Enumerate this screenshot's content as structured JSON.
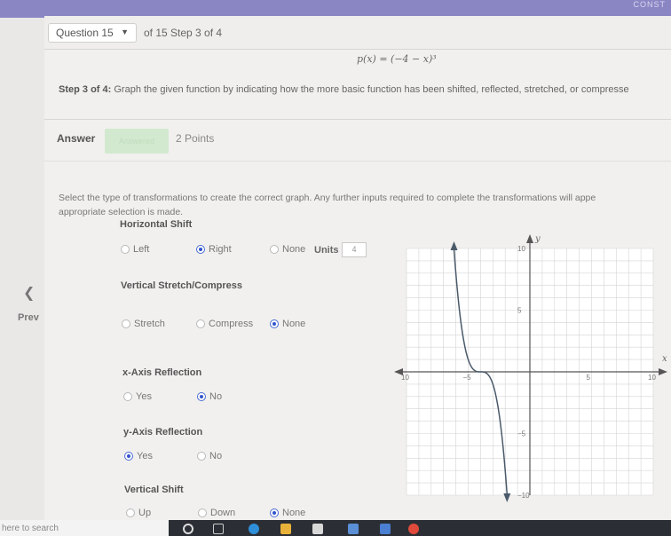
{
  "app": {
    "top_right_text": "CONST"
  },
  "header": {
    "question_select": "Question 15",
    "of_step": "of 15 Step 3 of 4"
  },
  "problem": {
    "function": "p(x) = (−4 − x)³",
    "step_label": "Step 3 of 4:",
    "step_text": "Graph the given function by indicating how the more basic function has been shifted, reflected, stretched, or compresse"
  },
  "answer": {
    "label": "Answer",
    "button": "Answered",
    "points": "2 Points"
  },
  "instructions": {
    "line1": "Select the type of transformations to create the correct graph. Any further inputs required to complete the transformations will appe",
    "line2": "appropriate selection is made."
  },
  "horizontal_shift": {
    "title": "Horizontal Shift",
    "options": [
      "Left",
      "Right",
      "None"
    ],
    "selected": "Right",
    "units_label": "Units",
    "units_value": "4"
  },
  "vertical_stretch": {
    "title": "Vertical Stretch/Compress",
    "options": [
      "Stretch",
      "Compress",
      "None"
    ],
    "selected": "None"
  },
  "x_reflection": {
    "title": "x-Axis Reflection",
    "options": [
      "Yes",
      "No"
    ],
    "selected": "No"
  },
  "y_reflection": {
    "title": "y-Axis Reflection",
    "options": [
      "Yes",
      "No"
    ],
    "selected": "Yes"
  },
  "vertical_shift": {
    "title": "Vertical Shift",
    "options": [
      "Up",
      "Down",
      "None"
    ],
    "selected": "None"
  },
  "nav": {
    "prev": "Prev",
    "prev_icon": "chevron-left-icon"
  },
  "graph": {
    "x_label": "x",
    "y_label": "y",
    "x_ticks": [
      "10",
      "−5",
      "5",
      "10"
    ],
    "y_ticks": [
      "10",
      "5",
      "−5",
      "−10"
    ],
    "x_range": [
      -10,
      10
    ],
    "y_range": [
      -10,
      10
    ],
    "curve_center": [
      -4,
      0
    ],
    "colors": {
      "grid": "#d4d4d4",
      "axis": "#555555",
      "curve": "#4a5a6a",
      "background": "#ffffff"
    }
  },
  "taskbar": {
    "search_text": "here to search"
  }
}
